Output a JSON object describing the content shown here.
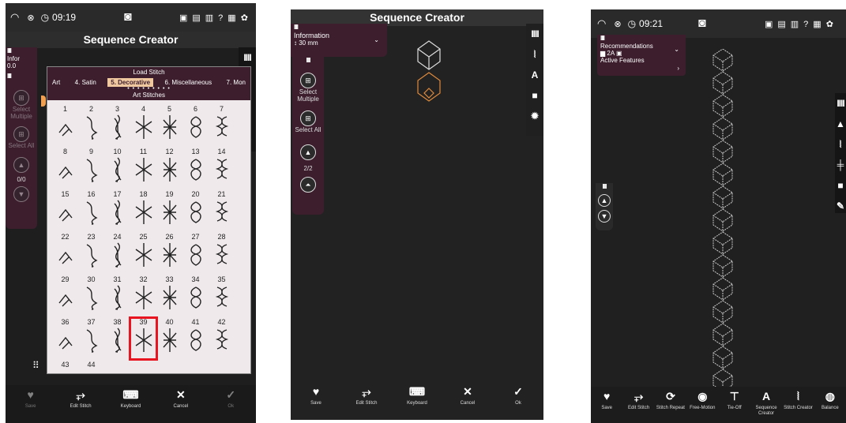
{
  "panel1": {
    "status": {
      "time": "09:19"
    },
    "title": "Sequence Creator",
    "info_label": "Infor",
    "info_value": "0.0",
    "select_multiple": "Select Multiple",
    "select_all": "Select All",
    "counter": "0/0",
    "dialog": {
      "title": "Load Stitch",
      "tabs": [
        "Art",
        "4. Satin",
        "5. Decorative",
        "6. Miscellaneous",
        "7. Mon"
      ],
      "active_tab": "5. Decorative",
      "subtitle": "Art Stitches",
      "numbers": [
        "1",
        "2",
        "3",
        "4",
        "5",
        "6",
        "7",
        "8",
        "9",
        "10",
        "11",
        "12",
        "13",
        "14",
        "15",
        "16",
        "17",
        "18",
        "19",
        "20",
        "21",
        "22",
        "23",
        "24",
        "25",
        "26",
        "27",
        "28",
        "29",
        "30",
        "31",
        "32",
        "33",
        "34",
        "35",
        "36",
        "37",
        "38",
        "39",
        "40",
        "41",
        "42",
        "43",
        "44"
      ],
      "highlighted": "39"
    },
    "bottom": [
      {
        "icon": "♥",
        "label": "Save",
        "icon_name": "heart-icon"
      },
      {
        "icon": "⥅",
        "label": "Edit Stitch",
        "icon_name": "edit-stitch-icon"
      },
      {
        "icon": "⌨",
        "label": "Keyboard",
        "icon_name": "keyboard-icon"
      },
      {
        "icon": "✕",
        "label": "Cancel",
        "icon_name": "close-icon"
      },
      {
        "icon": "✓",
        "label": "Ok",
        "icon_name": "check-icon"
      }
    ]
  },
  "panel2": {
    "title": "Sequence Creator",
    "info_label": "Information",
    "info_value": "30 mm",
    "select_multiple": "Select Multiple",
    "select_all": "Select All",
    "counter": "2/2",
    "bottom": [
      {
        "icon": "♥",
        "label": "Save",
        "icon_name": "heart-icon"
      },
      {
        "icon": "⥅",
        "label": "Edit Stitch",
        "icon_name": "edit-stitch-icon"
      },
      {
        "icon": "⌨",
        "label": "Keyboard",
        "icon_name": "keyboard-icon"
      },
      {
        "icon": "✕",
        "label": "Cancel",
        "icon_name": "close-icon"
      },
      {
        "icon": "✓",
        "label": "Ok",
        "icon_name": "check-icon"
      }
    ]
  },
  "panel3": {
    "status": {
      "time": "09:21"
    },
    "recommendations": "Recommendations",
    "rec_value": "2A",
    "active_features": "Active Features",
    "bottom": [
      {
        "icon": "♥",
        "label": "Save",
        "icon_name": "heart-icon"
      },
      {
        "icon": "⥅",
        "label": "Edit Stitch",
        "icon_name": "edit-stitch-icon"
      },
      {
        "icon": "⟳",
        "label": "Stitch Repeat",
        "icon_name": "repeat-icon"
      },
      {
        "icon": "◉",
        "label": "Free-Motion",
        "icon_name": "free-motion-icon"
      },
      {
        "icon": "⊤",
        "label": "Tie-Off",
        "icon_name": "tie-off-icon"
      },
      {
        "icon": "A",
        "label": "Sequence Creator",
        "icon_name": "sequence-creator-icon"
      },
      {
        "icon": "⦚",
        "label": "Stitch Creator",
        "icon_name": "stitch-creator-icon"
      },
      {
        "icon": "◍",
        "label": "Balance",
        "icon_name": "balance-icon"
      }
    ]
  },
  "colors": {
    "maroon": "#3c1e2d",
    "accent": "#f0c8a0",
    "highlight": "#e8141f",
    "stitch_orange": "#e08a3c"
  }
}
